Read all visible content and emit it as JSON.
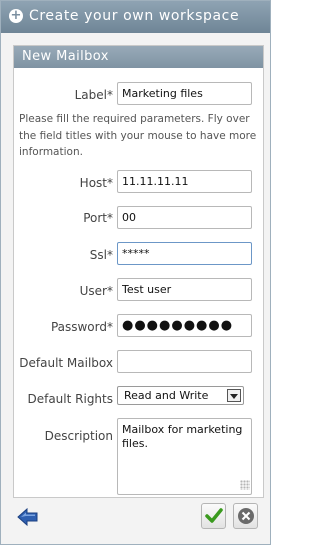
{
  "window": {
    "title": "Create your own workspace",
    "title_icon": "plus-circle-icon"
  },
  "panel": {
    "title": "New Mailbox"
  },
  "form": {
    "help_text": "Please fill the required parameters. Fly over the field titles with your mouse to have more information.",
    "label": {
      "label": "Label*",
      "value": "Marketing files"
    },
    "host": {
      "label": "Host*",
      "value": "11.11.11.11"
    },
    "port": {
      "label": "Port*",
      "value": "00"
    },
    "ssl": {
      "label": "Ssl*",
      "value": "*****"
    },
    "user": {
      "label": "User*",
      "value": "Test user"
    },
    "password": {
      "label": "Password*",
      "value": "●●●●●●●●●"
    },
    "default_mailbox": {
      "label": "Default Mailbox",
      "value": ""
    },
    "default_rights": {
      "label": "Default Rights",
      "selected": "Read and Write"
    },
    "description": {
      "label": "Description",
      "value": "Mailbox for marketing files."
    }
  },
  "actions": {
    "back_icon": "back-arrow-icon",
    "ok_icon": "checkmark-icon",
    "cancel_icon": "close-icon"
  },
  "colors": {
    "title_bar": "#7b8fa0",
    "ok_green": "#3a9a1e",
    "back_blue": "#2e5fb0"
  }
}
